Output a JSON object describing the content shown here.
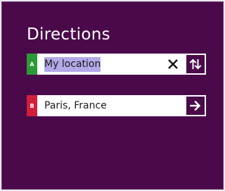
{
  "header": {
    "title": "Directions"
  },
  "start": {
    "marker": "A",
    "value": "My location",
    "marker_color": "#2b9a36",
    "clear_icon": "close-icon",
    "action_icon": "swap-icon"
  },
  "end": {
    "marker": "B",
    "value": "Paris, France",
    "marker_color": "#d11f3a",
    "action_icon": "arrow-right-icon"
  },
  "colors": {
    "background": "#4a0a4a",
    "selection": "#b4a9e8"
  }
}
